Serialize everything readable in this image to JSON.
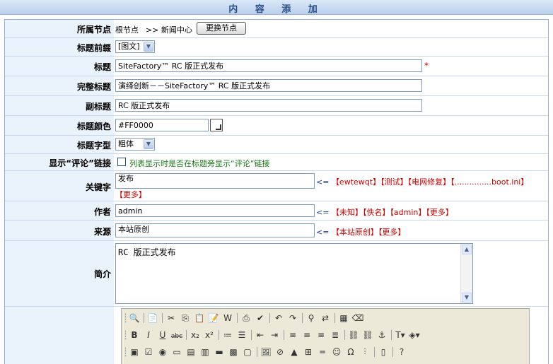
{
  "page_title": "内 容 添 加",
  "colon": "：",
  "fields": {
    "node": {
      "label": "所属节点",
      "root": "根节点",
      "path": ">> 新闻中心",
      "change_button": "更换节点"
    },
    "prefix": {
      "label": "标题前缀",
      "value": "[图文]"
    },
    "title": {
      "label": "标题",
      "value": "SiteFactory™ RC 版正式发布",
      "required_mark": "*"
    },
    "full_title": {
      "label": "完整标题",
      "value": "演绎创新－－SiteFactory™ RC 版正式发布"
    },
    "subtitle": {
      "label": "副标题",
      "value": "RC 版正式发布"
    },
    "title_color": {
      "label": "标题颜色",
      "value": "#FF0000"
    },
    "font_style": {
      "label": "标题字型",
      "value": "粗体"
    },
    "comment_link": {
      "label": "显示“评论”链接",
      "checkbox_text": "列表显示时是否在标题旁显示“评论”链接",
      "checked": false
    },
    "keywords": {
      "label": "关键字",
      "value": "发布",
      "arrow": "<=",
      "suggestions": [
        "【ewtewqt】",
        "【测试】",
        "【电网修复】",
        "【...............boot.ini】"
      ],
      "more": "【更多】"
    },
    "author": {
      "label": "作者",
      "value": "admin",
      "arrow": "<=",
      "suggestions": [
        "【未知】",
        "【佚名】",
        "【admin】"
      ],
      "more": "【更多】"
    },
    "source": {
      "label": "来源",
      "value": "本站原创",
      "arrow": "<=",
      "suggestions": [
        "【本站原创】"
      ],
      "more": "【更多】"
    },
    "summary": {
      "label": "简介",
      "value": "RC 版正式发布"
    }
  },
  "colors": {
    "accent": "#2a4c8a",
    "link_red": "#cc0000",
    "green_text": "#1a7a1a",
    "label_bg": "#eaf2fb"
  }
}
